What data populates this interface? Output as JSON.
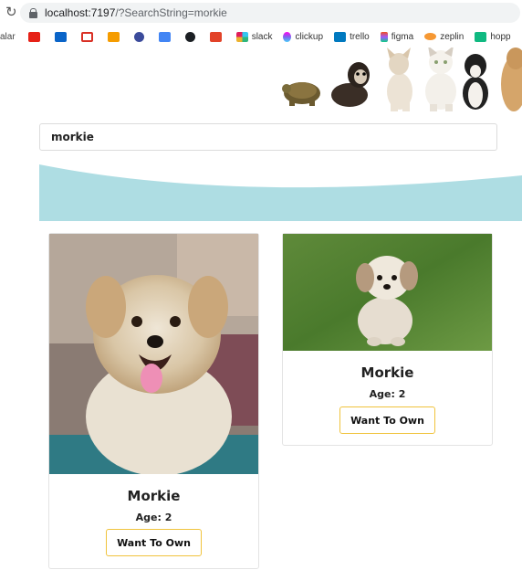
{
  "browser": {
    "url_host": "localhost:7197",
    "url_path": "/?SearchString=morkie"
  },
  "bookmarks": [
    {
      "label": "alar",
      "icon": "truncated-folder"
    },
    {
      "label": "",
      "icon": "youtube-icon",
      "color": "#e62117"
    },
    {
      "label": "",
      "icon": "outlook-icon",
      "color": "#0a64c8"
    },
    {
      "label": "",
      "icon": "gmail-icon",
      "color": "#d93025"
    },
    {
      "label": "",
      "icon": "mail-icon",
      "color": "#f59c00"
    },
    {
      "label": "",
      "icon": "globe-icon",
      "color": "#3b4b9b"
    },
    {
      "label": "",
      "icon": "translate-icon",
      "color": "#4285f4"
    },
    {
      "label": "",
      "icon": "github-icon",
      "color": "#1b1f23"
    },
    {
      "label": "",
      "icon": "gitlab-icon",
      "color": "#e24329"
    },
    {
      "label": "slack",
      "icon": "slack-icon",
      "color": "#e01e5a"
    },
    {
      "label": "clickup",
      "icon": "clickup-icon",
      "color": "#7b68ee"
    },
    {
      "label": "trello",
      "icon": "trello-icon",
      "color": "#0079bf"
    },
    {
      "label": "figma",
      "icon": "figma-icon",
      "color": "#f24e1e"
    },
    {
      "label": "zeplin",
      "icon": "zeplin-icon",
      "color": "#f69833"
    },
    {
      "label": "hopp",
      "icon": "hoppscotch-icon",
      "color": "#10b981"
    }
  ],
  "search": {
    "value": "morkie"
  },
  "colors": {
    "wave": "#aedde3",
    "button_border": "#f0c33c"
  },
  "cards": [
    {
      "name": "Morkie",
      "age": "Age: 2",
      "button": "Want To Own"
    },
    {
      "name": "Morkie",
      "age": "Age: 2",
      "button": "Want To Own"
    }
  ]
}
